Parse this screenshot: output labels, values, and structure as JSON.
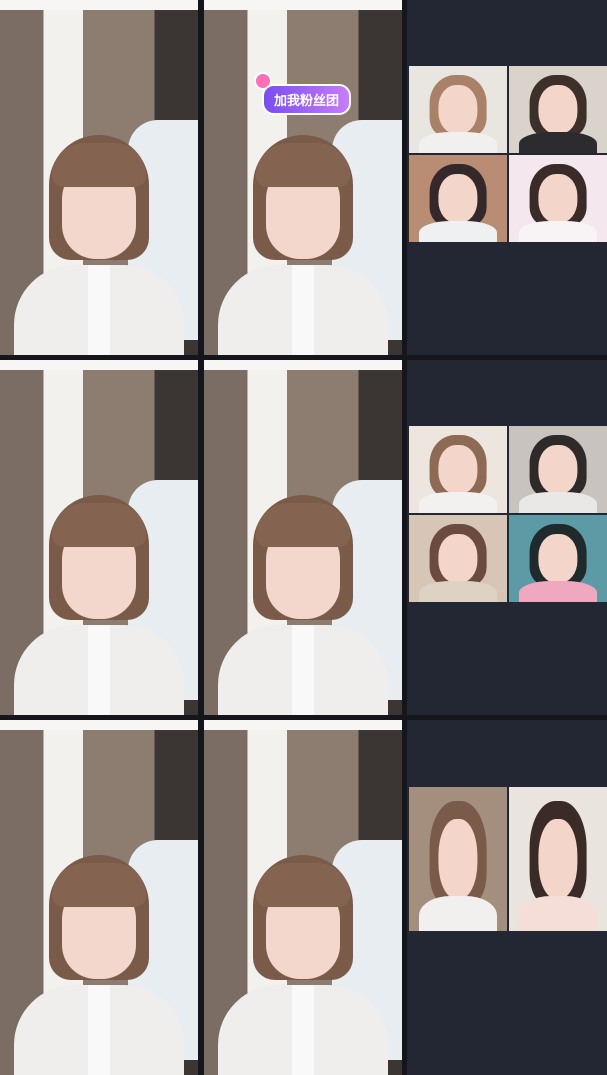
{
  "badge_text": "加我粉丝团",
  "colors": {
    "background": "#14161c",
    "panel": "#222733",
    "badge_start": "#7a4cf0",
    "badge_end": "#c77cf9"
  },
  "rows": [
    {
      "guests": [
        {
          "hair": "#a98169",
          "bg": "#e9e6e2",
          "body": "#f1f0ee"
        },
        {
          "hair": "#3d2f2a",
          "bg": "#d9d3cc",
          "body": "#2b2b30"
        },
        {
          "hair": "#35282a",
          "bg": "#b88d73",
          "body": "#eef0f2"
        },
        {
          "hair": "#3a2a28",
          "bg": "#f4e8ee",
          "body": "#f8f4f6"
        }
      ]
    },
    {
      "guests": [
        {
          "hair": "#8e6a55",
          "bg": "#ece6df",
          "body": "#f2f1ef"
        },
        {
          "hair": "#2f2a2a",
          "bg": "#c9c3bf",
          "body": "#e9e8e6"
        },
        {
          "hair": "#6b4b40",
          "bg": "#d7c6b6",
          "body": "#ddd2c4"
        },
        {
          "hair": "#1f2a2c",
          "bg": "#5c9aa6",
          "body": "#f0a8c0"
        }
      ]
    },
    {
      "guests": [
        {
          "hair": "#7a5b49",
          "bg": "#a48e7d",
          "body": "#f1f0ee"
        },
        {
          "hair": "#3a2b26",
          "bg": "#eae4de",
          "body": "#f6ded8"
        }
      ]
    }
  ]
}
